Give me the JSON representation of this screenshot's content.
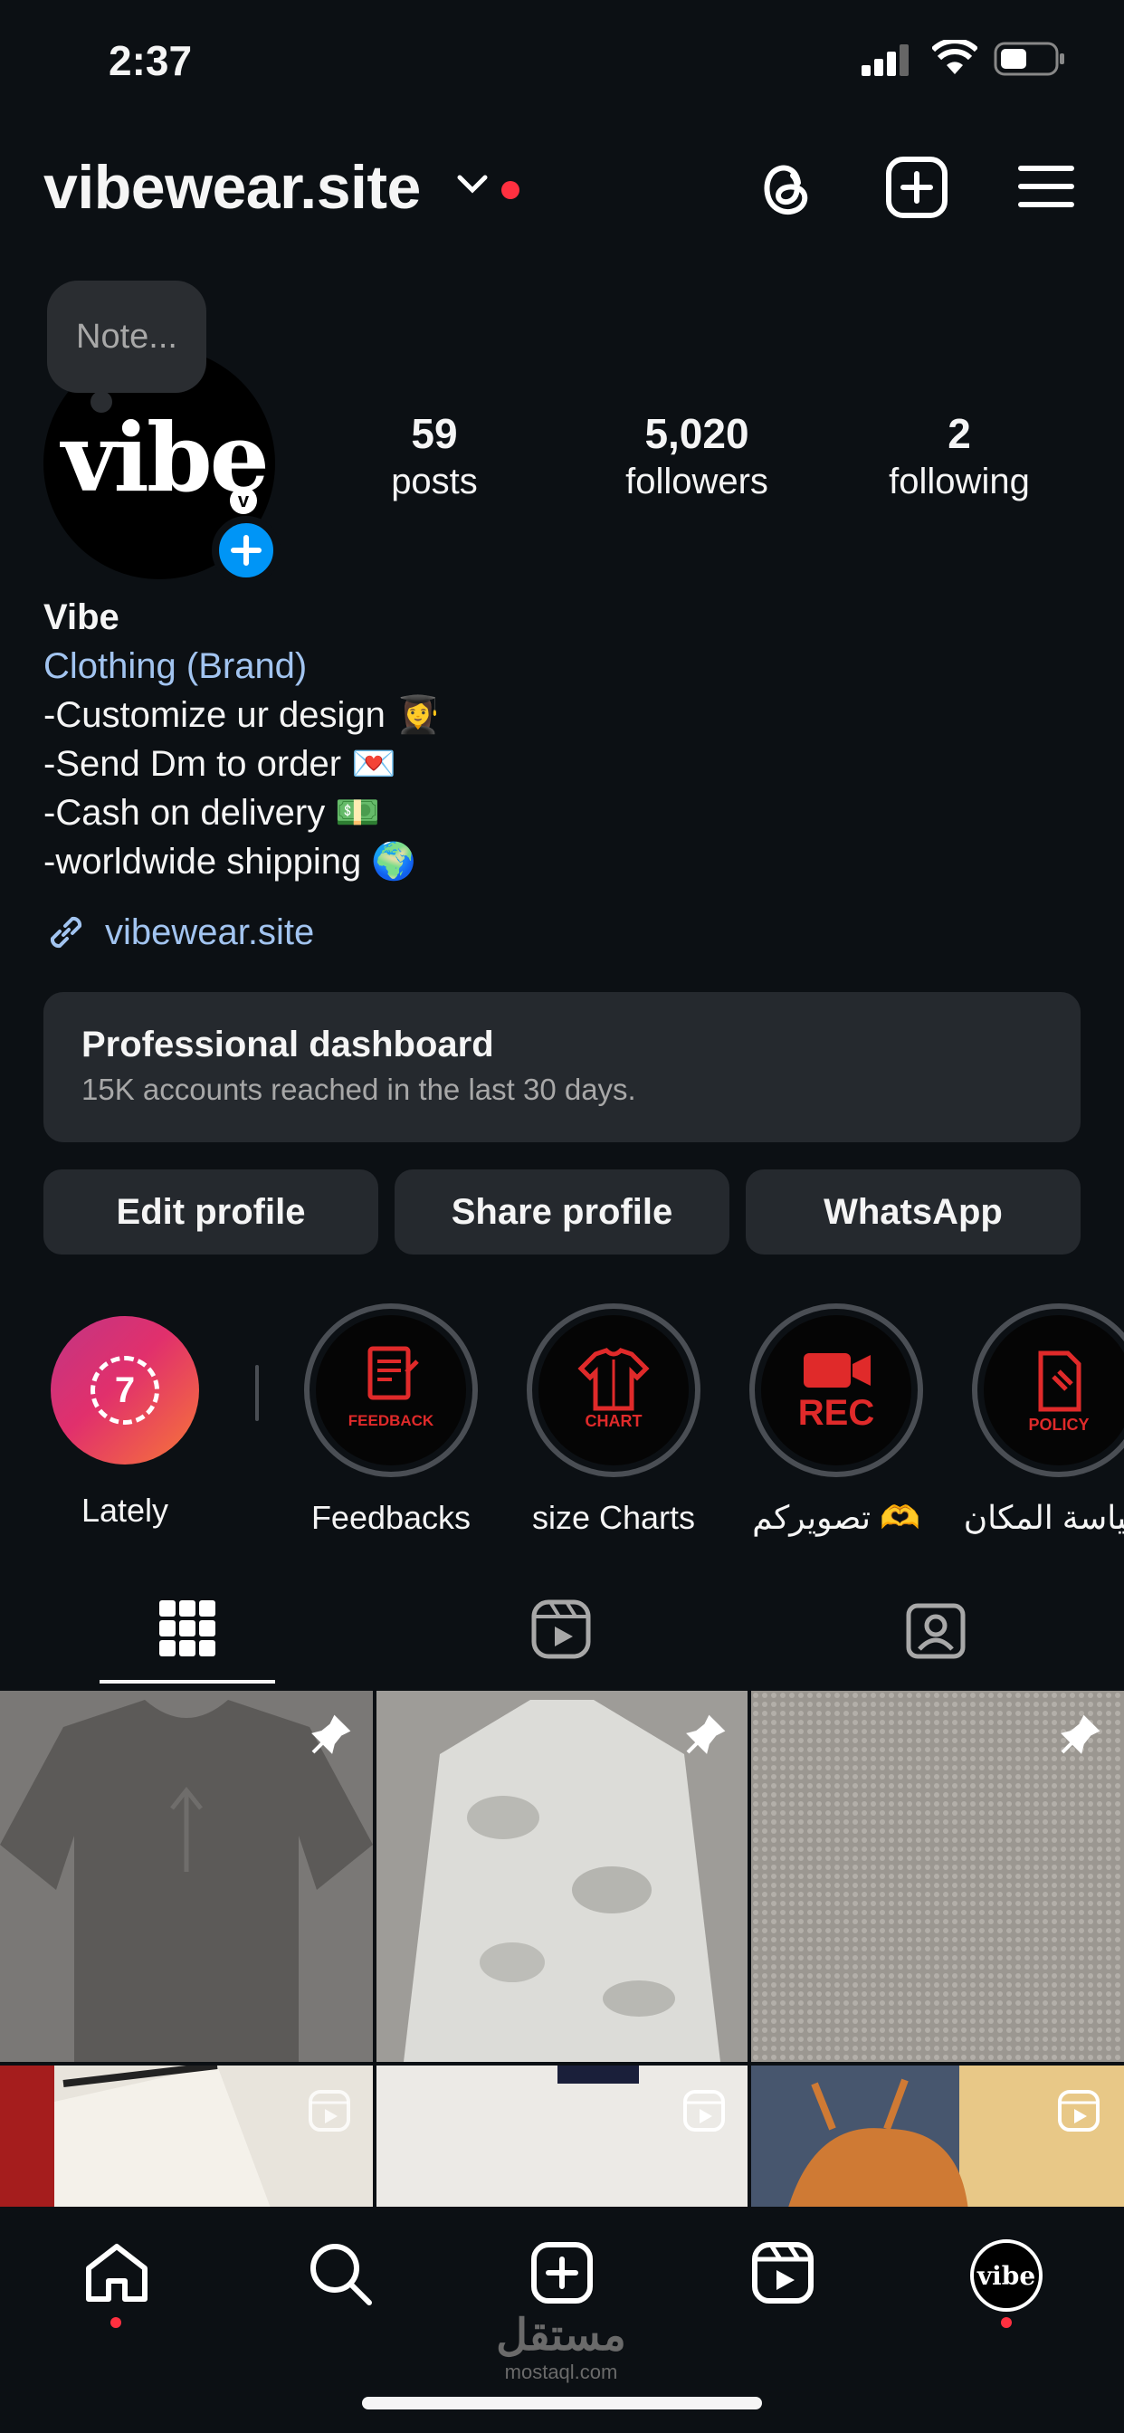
{
  "status_bar": {
    "time": "2:37"
  },
  "header": {
    "username": "vibewear.site"
  },
  "profile": {
    "note_placeholder": "Note...",
    "avatar_text": "vibe",
    "stats": [
      {
        "value": "59",
        "label": "posts"
      },
      {
        "value": "5,020",
        "label": "followers"
      },
      {
        "value": "2",
        "label": "following"
      }
    ],
    "name": "Vibe",
    "category": "Clothing (Brand)",
    "bio_lines": [
      "-Customize ur design 👩‍🎓",
      "-Send Dm to order 💌",
      "-Cash on delivery 💵",
      "-worldwide shipping 🌍"
    ],
    "link": "vibewear.site"
  },
  "dashboard": {
    "title": "Professional dashboard",
    "subtitle": "15K accounts reached in the last 30 days."
  },
  "buttons": {
    "edit": "Edit profile",
    "share": "Share profile",
    "whatsapp": "WhatsApp"
  },
  "highlights": [
    {
      "label": "Lately",
      "badge": "7"
    },
    {
      "label": "Feedbacks",
      "caption": "FEEDBACK"
    },
    {
      "label": "size Charts",
      "caption": "CHART"
    },
    {
      "label": "تصويركم 🫶",
      "caption": "REC"
    },
    {
      "label": "سياسة المكان",
      "caption": "POLICY"
    }
  ],
  "tabs": [
    "grid-icon",
    "reels-icon",
    "tagged-icon"
  ],
  "watermark": {
    "arabic": "مستقل",
    "latin": "mostaql.com"
  },
  "colors": {
    "background": "#0c1014",
    "surface": "#25292e",
    "link": "#a2c4f0",
    "accent_blue": "#0095f6",
    "notification_red": "#ff3040"
  }
}
